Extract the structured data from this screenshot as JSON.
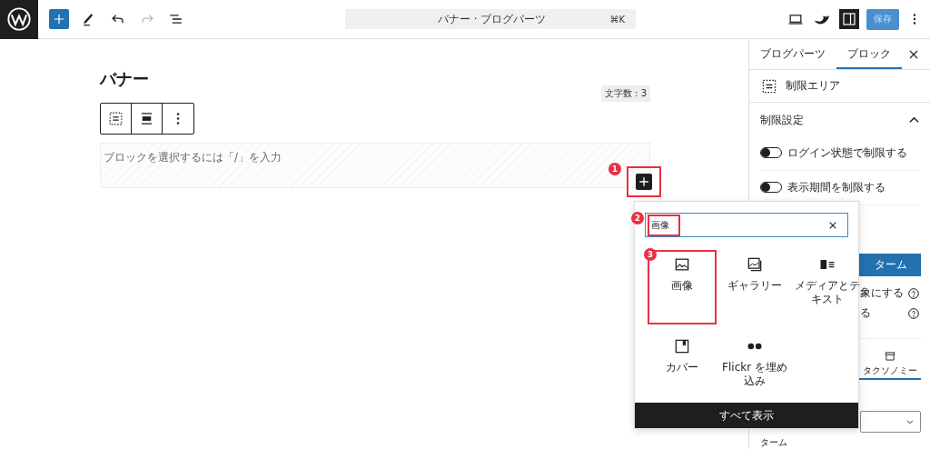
{
  "top_bar": {
    "add_block": {
      "selected": true
    },
    "undo": {
      "disabled": false
    },
    "redo": {
      "disabled": true
    },
    "command_bar": {
      "title": "バナー · ブログパーツ",
      "shortcut": "⌘K"
    },
    "settings_toggle": {
      "selected": true
    },
    "save_button": {
      "label": "保存",
      "disabled": true
    }
  },
  "editor": {
    "title": "バナー",
    "word_count": "文字数 : 3",
    "placeholder": "ブロックを選択するには「/」を入力",
    "inserter_button": {
      "annotation": "1"
    }
  },
  "inserter": {
    "search": {
      "value": "画像",
      "annotation": "2"
    },
    "results": [
      {
        "kind": "image",
        "label": "画像",
        "annotation": "3"
      },
      {
        "kind": "gallery",
        "label": "ギャラリー"
      },
      {
        "kind": "media-text",
        "label": "メディアとテキスト"
      },
      {
        "kind": "cover",
        "label": "カバー"
      },
      {
        "kind": "flickr",
        "label": "Flickr を埋め込み"
      }
    ],
    "footer": "すべて表示"
  },
  "sidebar": {
    "tabs": [
      {
        "label": "ブログパーツ",
        "selected": false
      },
      {
        "label": "ブロック",
        "selected": true
      }
    ],
    "block_name": "制限エリア",
    "panel": {
      "title": "制限設定",
      "expanded": true,
      "toggles": [
        {
          "label": "ログイン状態で制限する",
          "on": false
        },
        {
          "label": "表示期間を制限する",
          "on": false
        }
      ]
    },
    "covered": {
      "button": "ターム",
      "help_rows": [
        "象にする",
        "る"
      ],
      "tabs": [
        {
          "label": "タクソノミー",
          "selected": true
        }
      ],
      "field_label": "ターム"
    }
  }
}
